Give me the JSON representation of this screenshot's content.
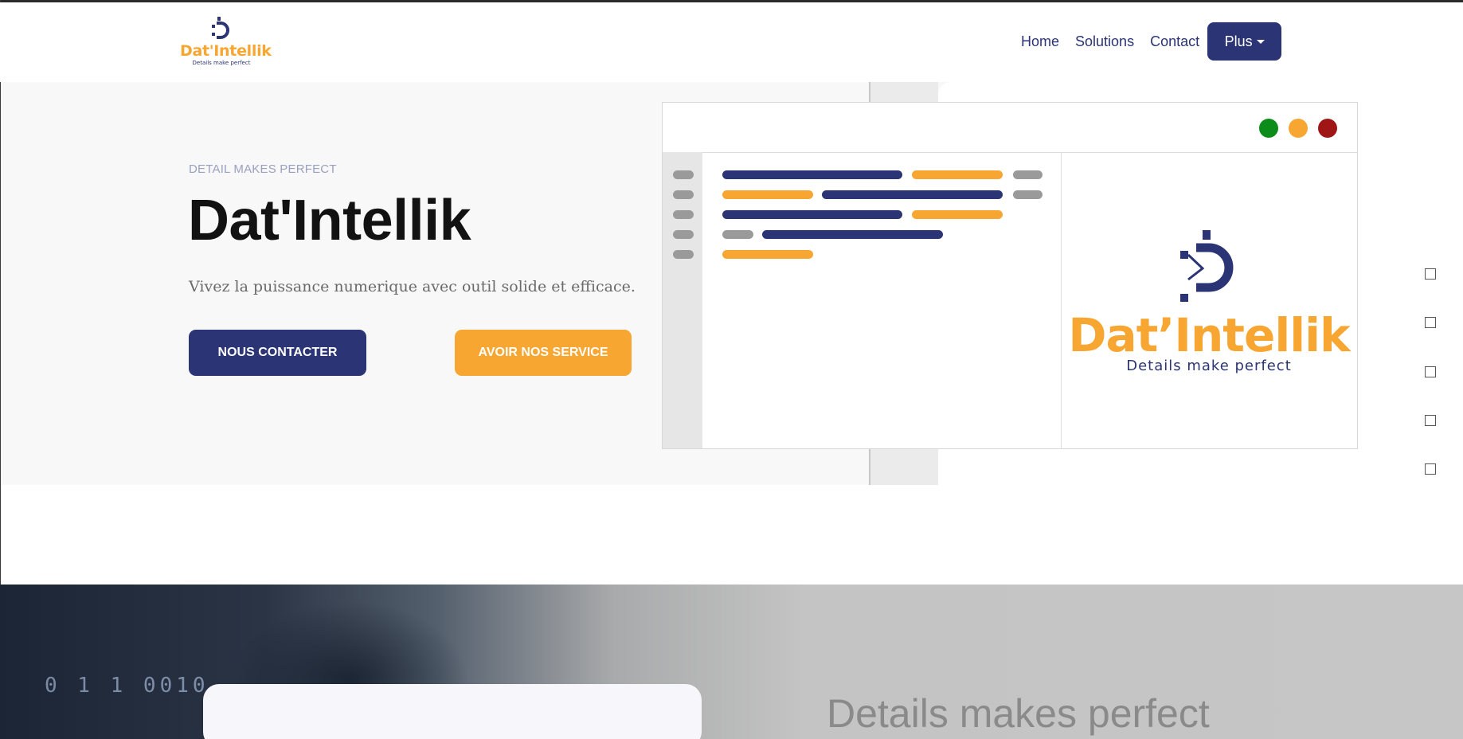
{
  "navbar": {
    "logo": {
      "brand": "Dat'Intellik",
      "slogan": "Details make perfect"
    },
    "links": [
      "Home",
      "Solutions",
      "Contact"
    ],
    "more_label": "Plus"
  },
  "hero": {
    "tagline": "DETAIL MAKES PERFECT",
    "title": "Dat'Intellik",
    "description": "Vivez la puissance numerique avec outil solide et efficace.",
    "contact_button": "NOUS CONTACTER",
    "service_button": "AVOIR NOS SERVICE"
  },
  "mockup": {
    "window_dots": [
      "green",
      "orange",
      "red"
    ],
    "logo": {
      "brand": "Dat’Intellik",
      "slogan": "Details make perfect"
    }
  },
  "banner": {
    "heading": "Details makes perfect",
    "background_digits": "0 1 1 0010"
  },
  "colors": {
    "navy": "#2b3474",
    "orange": "#f6a631",
    "green": "#0c8c18",
    "red": "#a01616",
    "hero_bg": "#f8f8f8"
  }
}
